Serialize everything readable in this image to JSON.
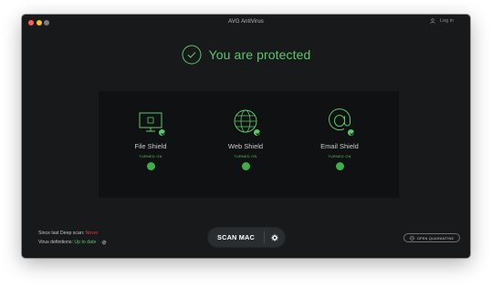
{
  "window": {
    "title": "AVG AntiVirus",
    "login_label": "Log in"
  },
  "status": {
    "text": "You are protected",
    "accent_color": "#5cc66a"
  },
  "shields": [
    {
      "name": "File Shield",
      "state": "TURNED ON",
      "enabled": true,
      "icon": "monitor-icon"
    },
    {
      "name": "Web Shield",
      "state": "TURNED ON",
      "enabled": true,
      "icon": "globe-icon"
    },
    {
      "name": "Email Shield",
      "state": "TURNED ON",
      "enabled": true,
      "icon": "at-sign-icon"
    }
  ],
  "footer": {
    "deep_scan_label": "Since last Deep scan:",
    "deep_scan_value": "Never",
    "definitions_label": "Virus definitions:",
    "definitions_value": "Up to date",
    "scan_button": "SCAN MAC",
    "quarantine_button": "OPEN QUARANTINE"
  },
  "colors": {
    "background": "#17191b",
    "success": "#5cc66a",
    "warning": "#e0393b"
  }
}
